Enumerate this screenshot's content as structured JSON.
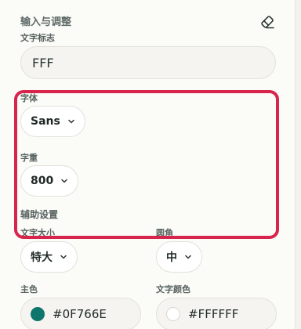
{
  "section": {
    "title": "输入与调整"
  },
  "text_mark": {
    "label": "文字标志",
    "value": "FFF"
  },
  "font": {
    "label": "字体",
    "selected": "Sans"
  },
  "weight": {
    "label": "字重",
    "selected": "800"
  },
  "aux": {
    "title": "辅助设置",
    "size_label": "文字大小",
    "size_selected": "特大",
    "radius_label": "圆角",
    "radius_selected": "中"
  },
  "colors": {
    "primary_label": "主色",
    "primary_value": "#0F766E",
    "text_color_label": "文字颜色",
    "text_color_value": "#FFFFFF",
    "highlight_border": "#D8254E"
  },
  "icons": {
    "clear": "eraser-icon",
    "dropdown": "chevron-down-icon"
  }
}
